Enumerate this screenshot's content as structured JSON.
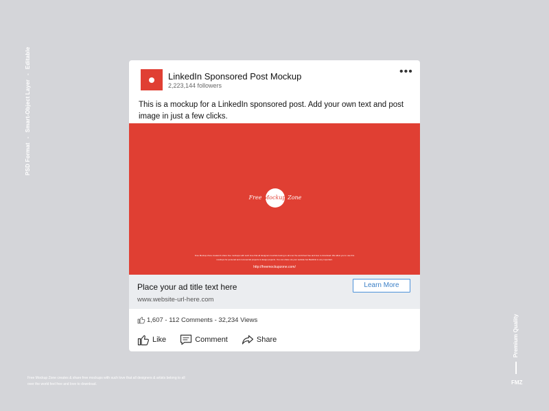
{
  "side": {
    "left_items": [
      "PSD Format",
      "Smart-Object Layer",
      "Editable"
    ],
    "separator": "-",
    "right_text": "Premium Quality",
    "logo": "FMZ"
  },
  "footnote": "Free Mockup Zone creates & share free mockups with such love that all designers & artists belong to all over the world feel free and love to download.",
  "post": {
    "company_name": "LinkedIn Sponsored Post Mockup",
    "followers": "2,223,144 followers",
    "more_icon": "more-dots-icon",
    "text": "This is a mockup for a LinkedIn sponsored post. Add your own text and post image in just a few clicks.",
    "image": {
      "brand_left": "Free",
      "brand_mid": "Mockup",
      "brand_right": "Zone",
      "fine_print": "Free Mockup Zone created & share free mockups with such love that all designers & artists belong to all over the world feel free and love to download. We allow you to use this mockups for personal and commercial projects & design projects. You can share via your website but Backlink is very important.",
      "url": "http://freemockupzone.com/"
    },
    "ad_title": "Place your ad title text here",
    "ad_url": "www.website-url-here.com",
    "cta": "Learn More",
    "stats": "1,607 - 112 Comments - 32,234 Views",
    "actions": {
      "like": "Like",
      "comment": "Comment",
      "share": "Share"
    },
    "brand_color": "#e03f33",
    "link_color": "#3a7fc6"
  }
}
